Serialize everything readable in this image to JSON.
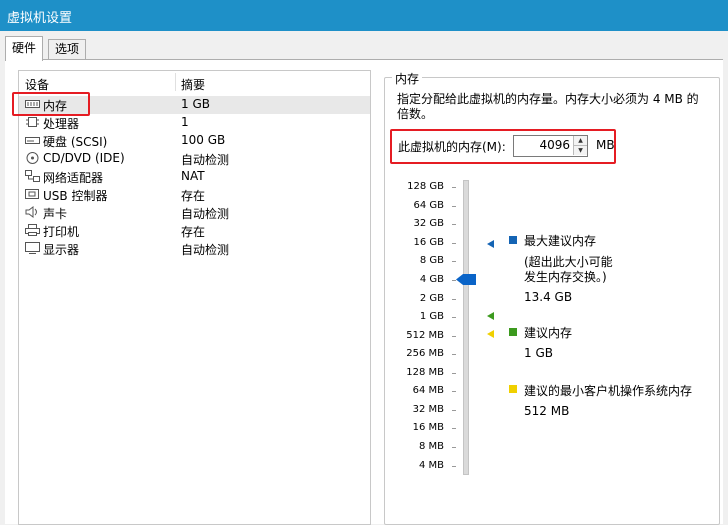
{
  "window": {
    "title": "虚拟机设置"
  },
  "tabs": [
    {
      "label": "硬件"
    },
    {
      "label": "选项"
    }
  ],
  "device_list": {
    "headers": {
      "device": "设备",
      "summary": "摘要"
    },
    "rows": [
      {
        "icon": "memory-icon",
        "name": "内存",
        "summary": "1 GB"
      },
      {
        "icon": "processor-icon",
        "name": "处理器",
        "summary": "1"
      },
      {
        "icon": "hard-disk-icon",
        "name": "硬盘 (SCSI)",
        "summary": "100 GB"
      },
      {
        "icon": "cd-dvd-icon",
        "name": "CD/DVD (IDE)",
        "summary": "自动检测"
      },
      {
        "icon": "network-adapter-icon",
        "name": "网络适配器",
        "summary": "NAT"
      },
      {
        "icon": "usb-controller-icon",
        "name": "USB 控制器",
        "summary": "存在"
      },
      {
        "icon": "sound-card-icon",
        "name": "声卡",
        "summary": "自动检测"
      },
      {
        "icon": "printer-icon",
        "name": "打印机",
        "summary": "存在"
      },
      {
        "icon": "display-icon",
        "name": "显示器",
        "summary": "自动检测"
      }
    ],
    "selected": "内存"
  },
  "memory": {
    "group_title": "内存",
    "description": "指定分配给此虚拟机的内存量。内存大小必须为 4 MB 的倍数。",
    "field_label": "此虚拟机的内存(M):",
    "value": "4096",
    "unit": "MB",
    "scale_labels": [
      "128 GB",
      "64 GB",
      "32 GB",
      "16 GB",
      "8 GB",
      "4 GB",
      "2 GB",
      "1 GB",
      "512 MB",
      "256 MB",
      "128 MB",
      "64 MB",
      "32 MB",
      "16 MB",
      "8 MB",
      "4 MB"
    ],
    "slider_value": "4 GB",
    "legend": {
      "max_title": "最大建议内存",
      "max_note_1": "(超出此大小可能",
      "max_note_2": "发生内存交换。)",
      "max_value": "13.4 GB",
      "rec_title": "建议内存",
      "rec_value": "1 GB",
      "min_title": "建议的最小客户机操作系统内存",
      "min_value": "512 MB"
    }
  },
  "colors": {
    "titlebar": "#1e90c8",
    "max_marker": "#1464b4",
    "rec_marker": "#3c9a1e",
    "min_marker": "#f0d000",
    "highlight": "#e51c23"
  }
}
